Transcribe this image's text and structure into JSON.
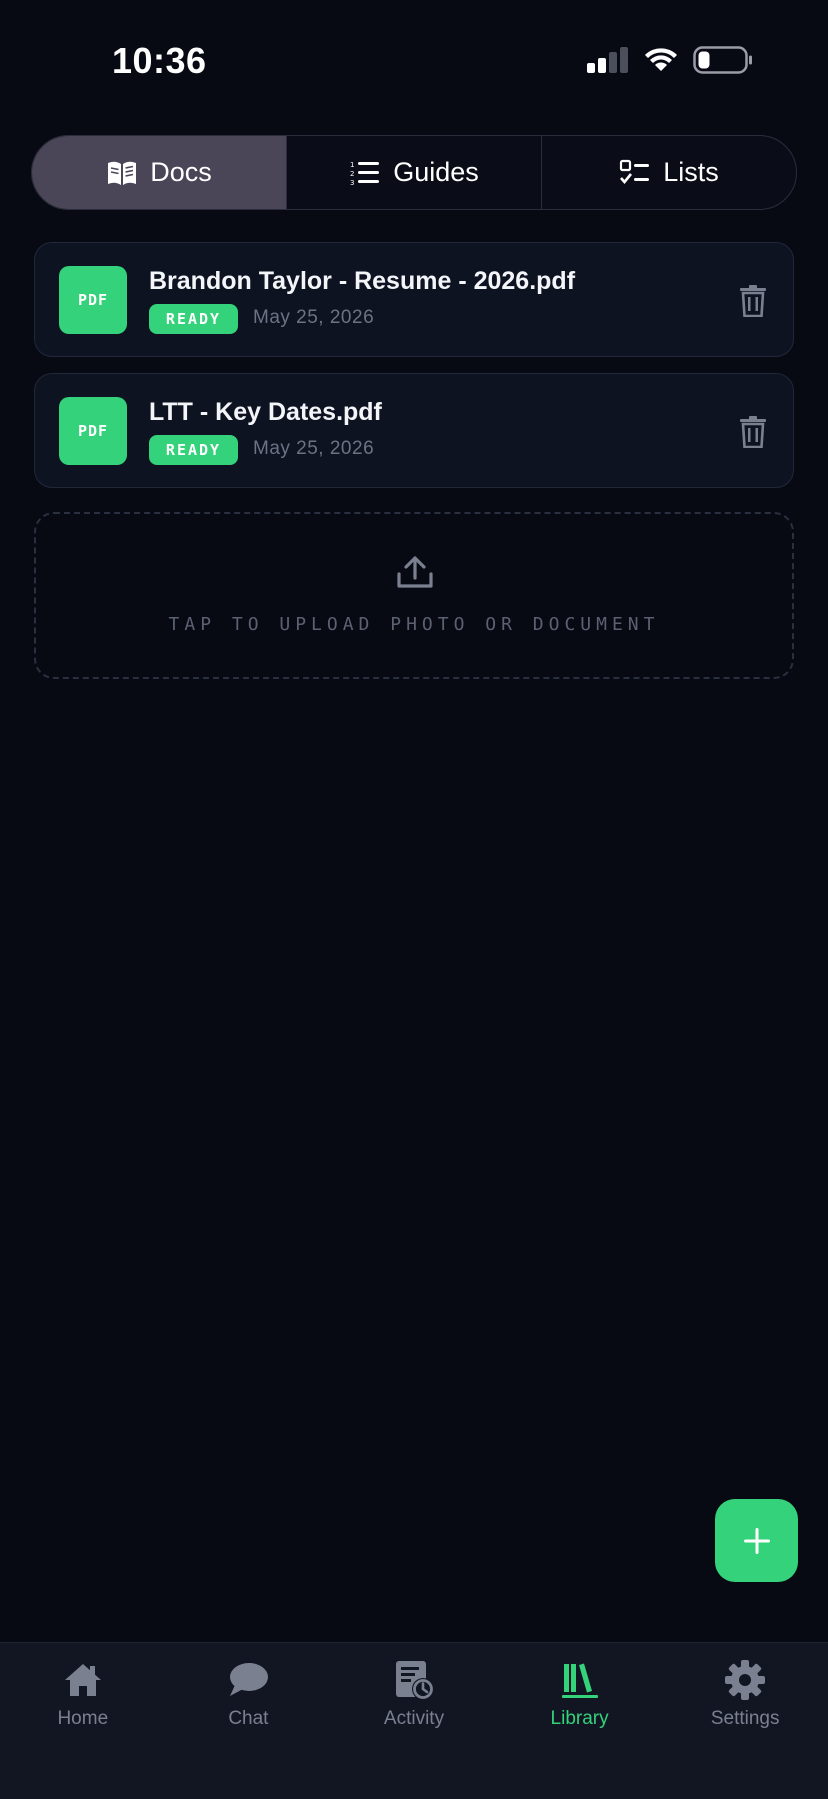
{
  "status_bar": {
    "time": "10:36"
  },
  "tabs": [
    {
      "label": "Docs",
      "icon": "book-open-icon",
      "active": true
    },
    {
      "label": "Guides",
      "icon": "numbered-list-icon",
      "active": false
    },
    {
      "label": "Lists",
      "icon": "checklist-icon",
      "active": false
    }
  ],
  "documents": [
    {
      "thumb": "PDF",
      "title": "Brandon Taylor - Resume - 2026.pdf",
      "status": "READY",
      "date": "May 25, 2026"
    },
    {
      "thumb": "PDF",
      "title": "LTT - Key Dates.pdf",
      "status": "READY",
      "date": "May 25, 2026"
    }
  ],
  "upload": {
    "label": "TAP TO UPLOAD PHOTO OR DOCUMENT",
    "icon": "upload-icon"
  },
  "fab": {
    "icon": "plus-icon"
  },
  "bottom_nav": [
    {
      "label": "Home",
      "icon": "home-icon",
      "active": false
    },
    {
      "label": "Chat",
      "icon": "chat-bubble-icon",
      "active": false
    },
    {
      "label": "Activity",
      "icon": "activity-icon",
      "active": false
    },
    {
      "label": "Library",
      "icon": "library-icon",
      "active": true
    },
    {
      "label": "Settings",
      "icon": "gear-icon",
      "active": false
    }
  ],
  "colors": {
    "background": "#070a13",
    "accent": "#34d27a",
    "card": "#0e1322",
    "active_tab": "#4a4658",
    "muted_text": "#7b8091"
  }
}
